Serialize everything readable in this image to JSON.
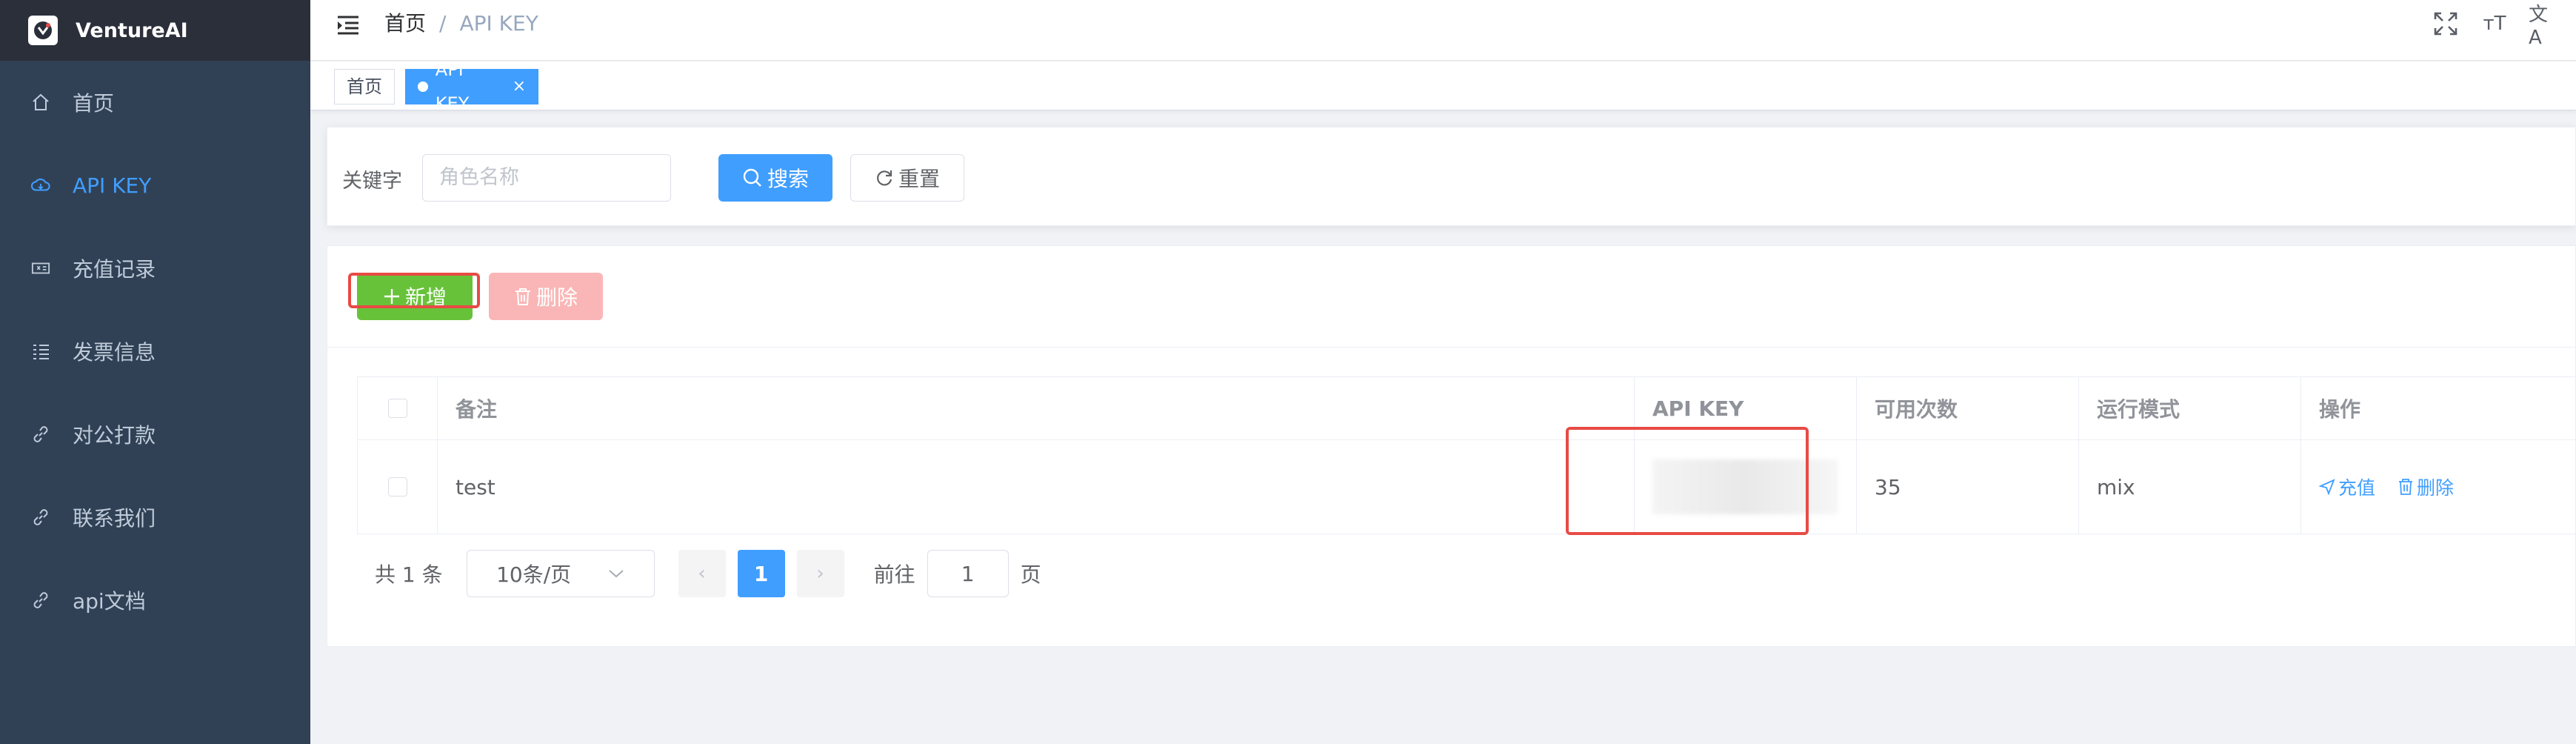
{
  "app": {
    "name": "VentureAI"
  },
  "sidebar": {
    "items": [
      {
        "label": "首页",
        "icon": "home-icon"
      },
      {
        "label": "API KEY",
        "icon": "cloud-icon",
        "active": true
      },
      {
        "label": "充值记录",
        "icon": "ticket-icon"
      },
      {
        "label": "发票信息",
        "icon": "list-icon"
      },
      {
        "label": "对公打款",
        "icon": "link-icon"
      },
      {
        "label": "联系我们",
        "icon": "link-icon"
      },
      {
        "label": "api文档",
        "icon": "link-icon"
      }
    ]
  },
  "header": {
    "breadcrumb": {
      "home": "首页",
      "separator": "/",
      "current": "API KEY"
    },
    "icons": [
      "fullscreen-icon",
      "font-size-icon",
      "translate-icon"
    ],
    "translate_glyph": "文A",
    "fontsize_glyph": "тT"
  },
  "tags": {
    "home": "首页",
    "active": "API KEY",
    "close": "×"
  },
  "search": {
    "keyword_label": "关键字",
    "keyword_placeholder": "角色名称",
    "search_button": "搜索",
    "reset_button": "重置"
  },
  "toolbar": {
    "add_button": "新增",
    "delete_button": "删除"
  },
  "table": {
    "columns": {
      "remark": "备注",
      "api_key": "API KEY",
      "count": "可用次数",
      "mode": "运行模式",
      "ops": "操作"
    },
    "rows": [
      {
        "remark": "test",
        "api_key": "",
        "count": "35",
        "mode": "mix",
        "recharge": "充值",
        "delete": "删除"
      }
    ]
  },
  "pagination": {
    "total_text": "共 1 条",
    "page_size": "10条/页",
    "current_page": "1",
    "goto_label": "前往",
    "goto_value": "1",
    "page_suffix": "页",
    "prev": "‹",
    "next": "›"
  },
  "colors": {
    "sidebar_bg": "#304156",
    "primary": "#409eff",
    "success": "#67c23a",
    "danger_light": "#fab6b6",
    "highlight_box": "#e84b45"
  }
}
